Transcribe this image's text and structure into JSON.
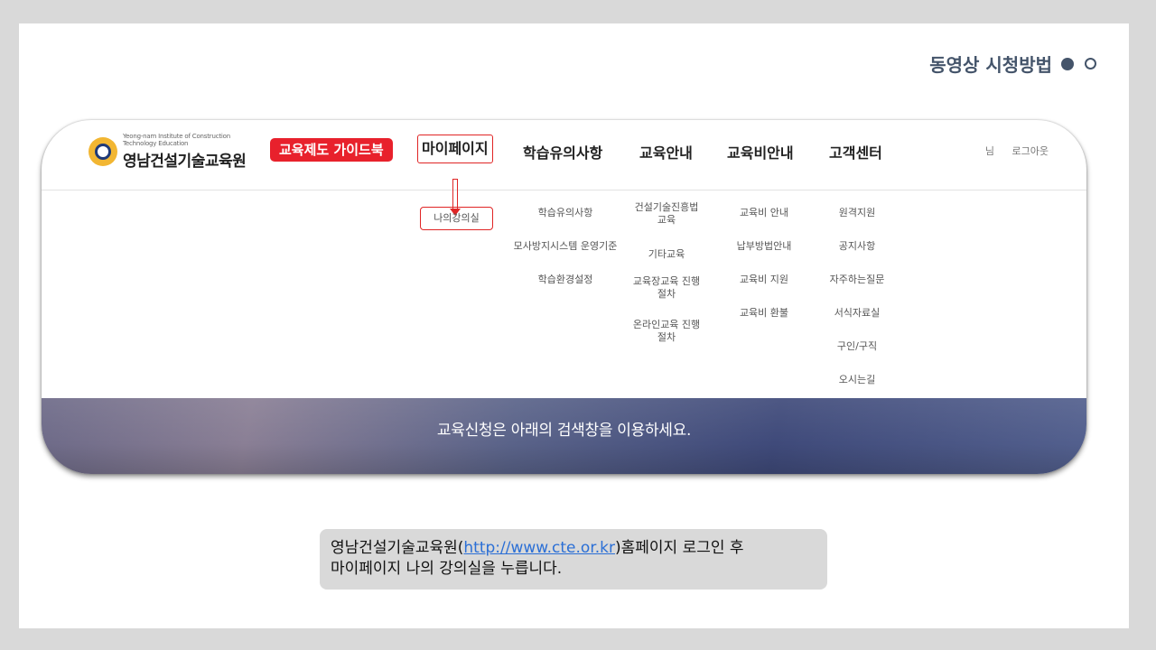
{
  "slide": {
    "title": "동영상 시청방법",
    "dots": [
      "filled",
      "empty"
    ],
    "colors": {
      "title": "#44546a",
      "accent_red": "#e8212c"
    }
  },
  "site": {
    "logo": {
      "subtitle": "Yeong-nam Institute of Construction Technology Education",
      "name": "영남건설기술교육원"
    },
    "nav": {
      "guide_button": "교육제도 가이드북",
      "items": [
        "마이페이지",
        "학습유의사항",
        "교육안내",
        "교육비안내",
        "고객센터"
      ]
    },
    "user": {
      "name_suffix": "님",
      "logout": "로그아웃"
    },
    "submenu": {
      "col1": [
        "나의강의실"
      ],
      "col2": [
        "학습유의사항",
        "모사방지시스템 운영기준",
        "학습환경설정"
      ],
      "col3": [
        "건설기술진흥법 교육",
        "기타교육",
        "교육장교육 진행절차",
        "온라인교육 진행절차"
      ],
      "col4": [
        "교육비 안내",
        "납부방법안내",
        "교육비 지원",
        "교육비 환불"
      ],
      "col5": [
        "원격지원",
        "공지사항",
        "자주하는질문",
        "서식자료실",
        "구인/구직",
        "오시는길"
      ]
    },
    "banner_text": "교육신청은 아래의 검색창을 이용하세요."
  },
  "caption": {
    "prefix": "영남건설기술교육원(",
    "link": "http://www.cte.or.kr",
    "suffix": ")홈페이지  로그인 후",
    "line2": "마이페이지 나의 강의실을 누릅니다."
  }
}
